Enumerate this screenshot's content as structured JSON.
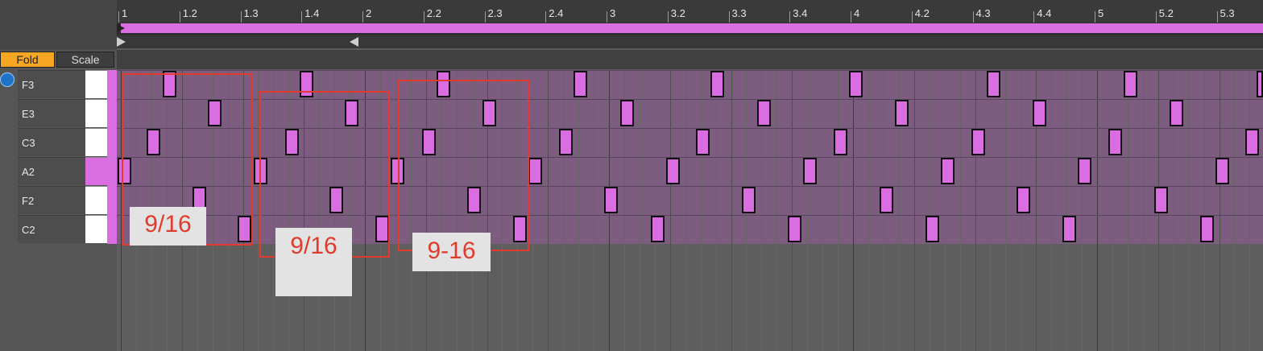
{
  "ruler": {
    "labels": [
      "1",
      "1.2",
      "1.3",
      "1.4",
      "2",
      "2.2",
      "2.3",
      "2.4",
      "3",
      "3.2",
      "3.3",
      "3.4",
      "4",
      "4.2",
      "4.3",
      "4.4",
      "5",
      "5.2",
      "5.3"
    ]
  },
  "buttons": {
    "fold": "Fold",
    "scale": "Scale"
  },
  "rows": [
    "F3",
    "E3",
    "C3",
    "A2",
    "F2",
    "C2"
  ],
  "annotations": {
    "box1": "9/16",
    "box2": "9/16",
    "box3": "9-16"
  },
  "icons": {
    "monitor": "record-monitor-icon"
  },
  "colors": {
    "note": "#d86ee0",
    "fold_active": "#f5a623",
    "annotation": "#e03b2c"
  }
}
